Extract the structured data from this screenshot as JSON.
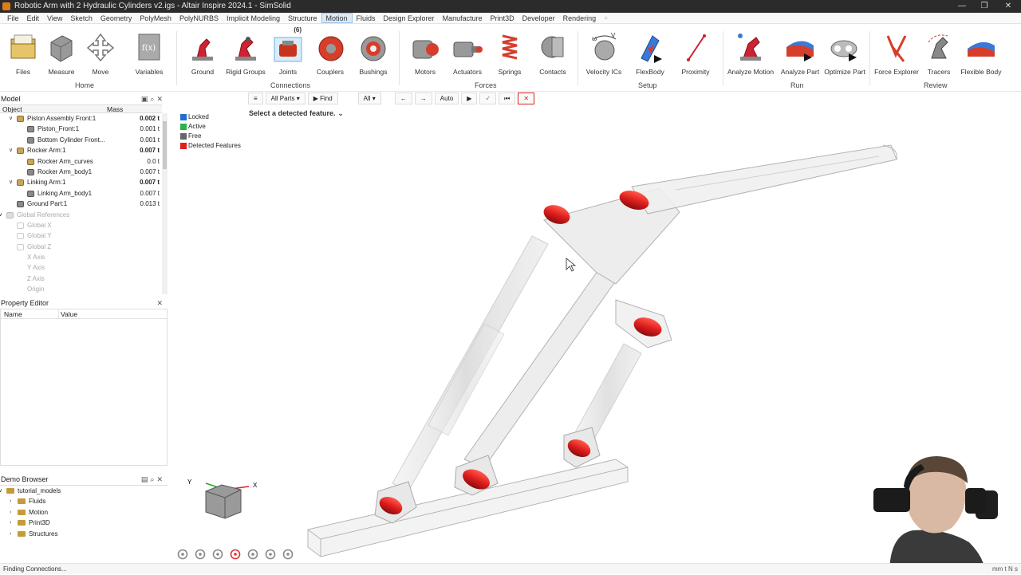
{
  "window": {
    "title": "Robotic Arm with 2 Hydraulic Cylinders v2.igs - Altair Inspire 2024.1 - SimSolid"
  },
  "menus": [
    "File",
    "Edit",
    "View",
    "Sketch",
    "Geometry",
    "PolyMesh",
    "PolyNURBS",
    "Implicit Modeling",
    "Structure",
    "Motion",
    "Fluids",
    "Design Explorer",
    "Manufacture",
    "Print3D",
    "Developer",
    "Rendering"
  ],
  "active_menu": "Motion",
  "ribbon": {
    "home": {
      "group": "Home",
      "files": "Files",
      "measure": "Measure",
      "move": "Move",
      "variables": "Variables"
    },
    "connections": {
      "group": "Connections",
      "ground": "Ground",
      "rigid_groups": "Rigid Groups",
      "joints": "Joints",
      "joints_badge": "(6)",
      "couplers": "Couplers",
      "bushings": "Bushings"
    },
    "forces": {
      "group": "Forces",
      "motors": "Motors",
      "actuators": "Actuators",
      "springs": "Springs",
      "contacts": "Contacts"
    },
    "setup": {
      "group": "Setup",
      "velocity_ics": "Velocity ICs",
      "flexbody": "FlexBody",
      "proximity": "Proximity"
    },
    "run": {
      "group": "Run",
      "analyze_motion": "Analyze Motion",
      "analyze_part": "Analyze Part",
      "optimize_part": "Optimize Part"
    },
    "review": {
      "group": "Review",
      "force_explorer": "Force Explorer",
      "tracers": "Tracers",
      "flexible_body": "Flexible Body"
    }
  },
  "model_panel": {
    "title": "Model",
    "col_object": "Object",
    "col_mass": "Mass",
    "rows": [
      {
        "name": "Piston Assembly Front:1",
        "mass": "0.002 t"
      },
      {
        "name": "Piston_Front:1",
        "mass": "0.001 t"
      },
      {
        "name": "Bottom Cylinder Front...",
        "mass": "0.001 t"
      },
      {
        "name": "Rocker Arm:1",
        "mass": "0.007 t"
      },
      {
        "name": "Rocker Arm_curves",
        "mass": "0.0 t"
      },
      {
        "name": "Rocker Arm_body1",
        "mass": "0.007 t"
      },
      {
        "name": "Linking Arm:1",
        "mass": "0.007 t"
      },
      {
        "name": "Linking Arm_body1",
        "mass": "0.007 t"
      },
      {
        "name": "Ground Part:1",
        "mass": "0.013 t"
      },
      {
        "name": "Global References",
        "mass": ""
      },
      {
        "name": "Global X",
        "mass": ""
      },
      {
        "name": "Global Y",
        "mass": ""
      },
      {
        "name": "Global Z",
        "mass": ""
      },
      {
        "name": "X Axis",
        "mass": ""
      },
      {
        "name": "Y Axis",
        "mass": ""
      },
      {
        "name": "Z Axis",
        "mass": ""
      },
      {
        "name": "Origin",
        "mass": ""
      }
    ]
  },
  "property_editor": {
    "title": "Property Editor",
    "col_name": "Name",
    "col_value": "Value"
  },
  "demo_browser": {
    "title": "Demo Browser",
    "items": [
      "tutorial_models",
      "Fluids",
      "Motion",
      "Print3D",
      "Structures"
    ]
  },
  "context_toolbar": {
    "filter": "All Parts",
    "find": "Find",
    "all": "All",
    "auto": "Auto"
  },
  "hint": "Select a detected feature.",
  "legend": [
    {
      "label": "Locked",
      "color": "#1f6fd1"
    },
    {
      "label": "Active",
      "color": "#2bb24c"
    },
    {
      "label": "Free",
      "color": "#666666"
    },
    {
      "label": "Detected Features",
      "color": "#e01e1e"
    }
  ],
  "triad": {
    "x": "X",
    "y": "Y"
  },
  "status": {
    "left": "Finding Connections...",
    "right": "mm t N s"
  },
  "colors": {
    "accent": "#9cc2ea",
    "joint_red": "#e01e1e"
  }
}
